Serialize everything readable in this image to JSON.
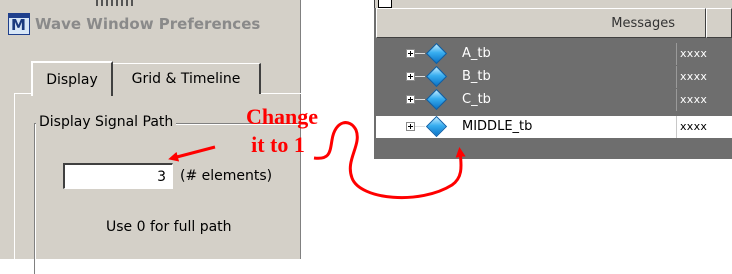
{
  "dialog": {
    "title": "Wave Window Preferences",
    "tabs": [
      {
        "label": "Display",
        "active": true
      },
      {
        "label": "Grid & Timeline",
        "active": false
      }
    ],
    "group_label": "Display Signal Path",
    "signal_path_value": "3",
    "unit_label": "(# elements)",
    "hint": "Use 0 for full path"
  },
  "wave": {
    "columns": {
      "messages": "Messages",
      "value": ""
    },
    "signals": [
      {
        "name": "A_tb",
        "value": "xxxx",
        "selected": false
      },
      {
        "name": "B_tb",
        "value": "xxxx",
        "selected": false
      },
      {
        "name": "C_tb",
        "value": "xxxx",
        "selected": false
      },
      {
        "name": "MIDDLE_tb",
        "value": "xxxx",
        "selected": true
      }
    ]
  },
  "annotation": {
    "line1": "Change",
    "line2": "it to 1",
    "color": "#ff0000"
  },
  "icons": {
    "app": "modelsim-m-icon",
    "expand": "plus-expander-icon",
    "signal": "signal-diamond-icon"
  }
}
